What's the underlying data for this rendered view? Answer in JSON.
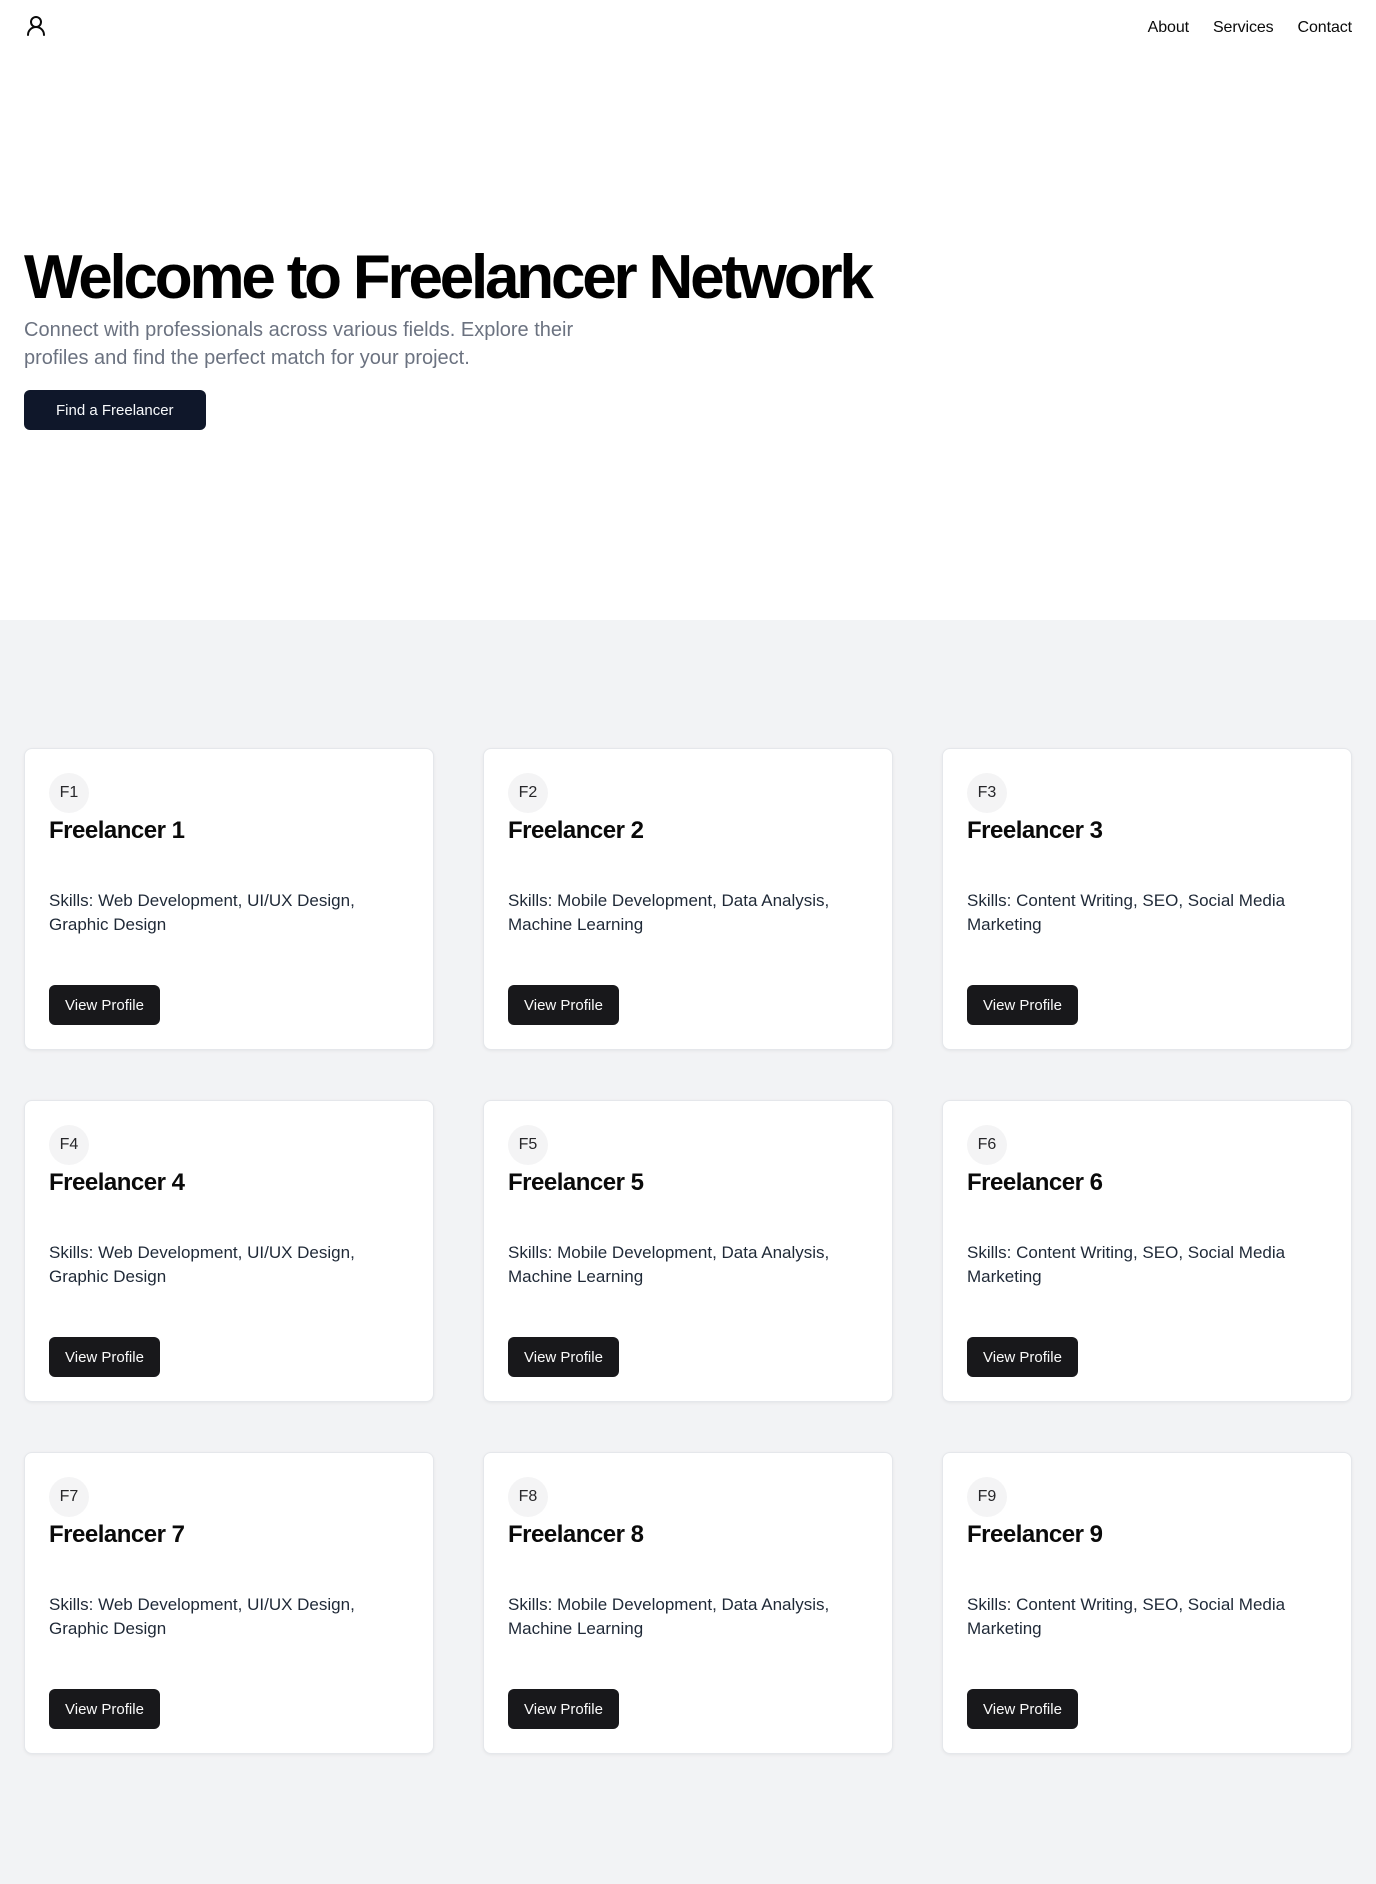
{
  "header": {
    "logo_icon": "user-icon",
    "nav": [
      {
        "label": "About"
      },
      {
        "label": "Services"
      },
      {
        "label": "Contact"
      }
    ]
  },
  "hero": {
    "title": "Welcome to Freelancer Network",
    "subtitle": "Connect with professionals across various fields. Explore their profiles and find the perfect match for your project.",
    "cta_label": "Find a Freelancer"
  },
  "freelancers": [
    {
      "initials": "F1",
      "name": "Freelancer 1",
      "skills": "Skills: Web Development, UI/UX Design, Graphic Design",
      "button": "View Profile"
    },
    {
      "initials": "F2",
      "name": "Freelancer 2",
      "skills": "Skills: Mobile Development, Data Analysis, Machine Learning",
      "button": "View Profile"
    },
    {
      "initials": "F3",
      "name": "Freelancer 3",
      "skills": "Skills: Content Writing, SEO, Social Media Marketing",
      "button": "View Profile"
    },
    {
      "initials": "F4",
      "name": "Freelancer 4",
      "skills": "Skills: Web Development, UI/UX Design, Graphic Design",
      "button": "View Profile"
    },
    {
      "initials": "F5",
      "name": "Freelancer 5",
      "skills": "Skills: Mobile Development, Data Analysis, Machine Learning",
      "button": "View Profile"
    },
    {
      "initials": "F6",
      "name": "Freelancer 6",
      "skills": "Skills: Content Writing, SEO, Social Media Marketing",
      "button": "View Profile"
    },
    {
      "initials": "F7",
      "name": "Freelancer 7",
      "skills": "Skills: Web Development, UI/UX Design, Graphic Design",
      "button": "View Profile"
    },
    {
      "initials": "F8",
      "name": "Freelancer 8",
      "skills": "Skills: Mobile Development, Data Analysis, Machine Learning",
      "button": "View Profile"
    },
    {
      "initials": "F9",
      "name": "Freelancer 9",
      "skills": "Skills: Content Writing, SEO, Social Media Marketing",
      "button": "View Profile"
    }
  ],
  "colors": {
    "hero_button_bg": "#0f172a",
    "card_button_bg": "#18181b",
    "listing_bg": "#f2f3f5",
    "subtitle_text": "#6b7280"
  }
}
